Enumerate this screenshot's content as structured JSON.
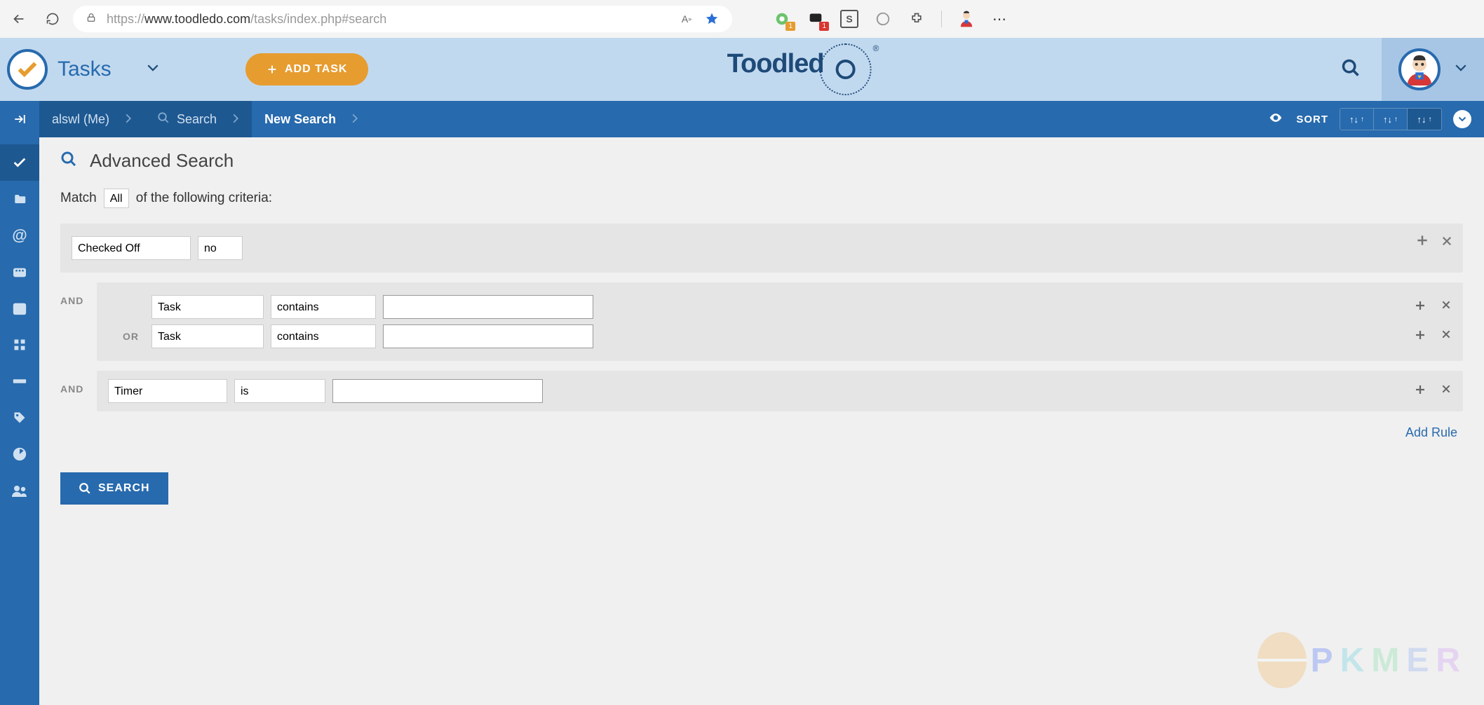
{
  "browser": {
    "url_protocol": "https://",
    "url_domain": "www.toodledo.com",
    "url_path": "/tasks/index.php#search"
  },
  "header": {
    "app_section": "Tasks",
    "add_task_label": "ADD TASK",
    "brand_name": "Toodled"
  },
  "breadcrumb": {
    "user_label": "alswl (Me)",
    "search_label": "Search",
    "new_search_label": "New Search",
    "sort_label": "SORT"
  },
  "page": {
    "title": "Advanced Search",
    "match_prefix": "Match",
    "match_mode": "All",
    "match_suffix": "of the following criteria:",
    "add_rule_label": "Add Rule",
    "search_button": "SEARCH"
  },
  "labels": {
    "and": "AND",
    "or": "OR"
  },
  "rules": {
    "r1": {
      "field": "Checked Off",
      "op": "no"
    },
    "r2a": {
      "field": "Task",
      "op": "contains",
      "value": ""
    },
    "r2b": {
      "field": "Task",
      "op": "contains",
      "value": ""
    },
    "r3": {
      "field": "Timer",
      "op": "is",
      "value": ""
    }
  }
}
